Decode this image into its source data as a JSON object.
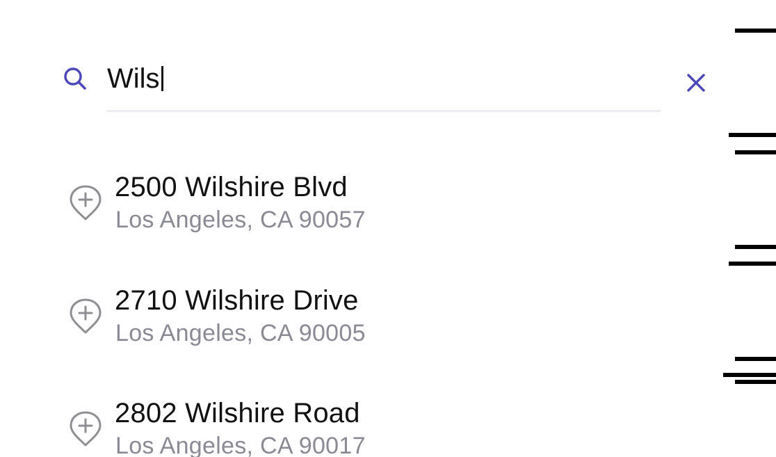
{
  "search": {
    "value": "Wils",
    "icon": "search-icon",
    "clear_icon": "close-icon",
    "accent_color": "#4b47b8"
  },
  "results": [
    {
      "title": "2500 Wilshire Blvd",
      "subtitle": "Los Angeles, CA 90057",
      "icon": "add-location-pin-icon"
    },
    {
      "title": "2710 Wilshire Drive",
      "subtitle": "Los Angeles, CA 90005",
      "icon": "add-location-pin-icon"
    },
    {
      "title": "2802 Wilshire Road",
      "subtitle": "Los Angeles, CA 90017",
      "icon": "add-location-pin-icon"
    }
  ],
  "colors": {
    "title_text": "#111111",
    "subtitle_text": "#8a8a94",
    "icon_gray": "#8e8e93",
    "underline": "#eceef3"
  }
}
